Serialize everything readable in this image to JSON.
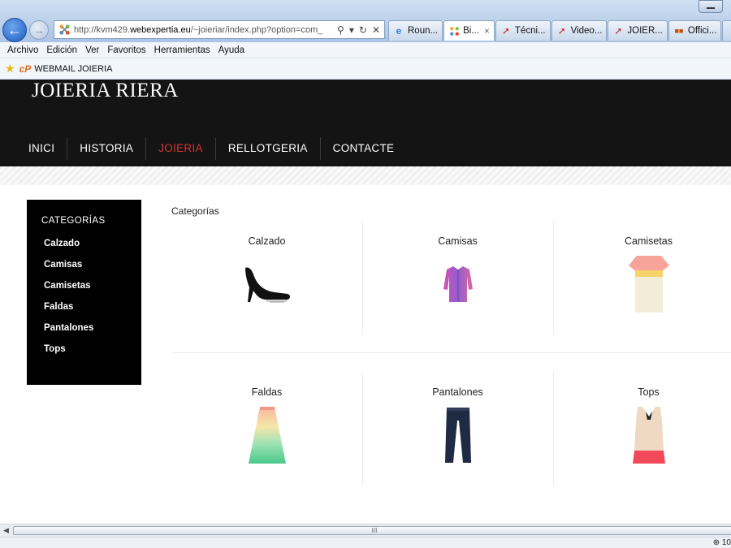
{
  "browser": {
    "url_prefix": "http://kvm429.",
    "url_domain": "webexpertia.eu",
    "url_rest": "/~joieriar/index.php?option=com_",
    "tabs": [
      {
        "label": "Roun...",
        "active": false
      },
      {
        "label": "Bi...",
        "active": true
      },
      {
        "label": "Técni...",
        "active": false
      },
      {
        "label": "Video...",
        "active": false
      },
      {
        "label": "JOIER...",
        "active": false
      },
      {
        "label": "Offici...",
        "active": false
      }
    ],
    "tab_close": "×",
    "menu": [
      "Archivo",
      "Edición",
      "Ver",
      "Favoritos",
      "Herramientas",
      "Ayuda"
    ],
    "favorite_link": "WEBMAIL JOIERIA",
    "favorite_cp": "cP",
    "scroll_grip": "III",
    "zoom": "10"
  },
  "site": {
    "title": "JOIERIA RIERA",
    "nav": [
      {
        "label": "INICI",
        "active": false
      },
      {
        "label": "HISTORIA",
        "active": false
      },
      {
        "label": "JOIERIA",
        "active": true
      },
      {
        "label": "RELLOTGERIA",
        "active": false
      },
      {
        "label": "CONTACTE",
        "active": false
      }
    ],
    "accent_color": "#d6332f"
  },
  "sidebar": {
    "title": "CATEGORÍAS",
    "items": [
      "Calzado",
      "Camisas",
      "Camisetas",
      "Faldas",
      "Pantalones",
      "Tops"
    ]
  },
  "content": {
    "heading": "Categorías",
    "categories": [
      {
        "label": "Calzado",
        "icon": "high-heel-shoe-icon"
      },
      {
        "label": "Camisas",
        "icon": "shirt-icon"
      },
      {
        "label": "Camisetas",
        "icon": "tshirt-icon"
      },
      {
        "label": "Faldas",
        "icon": "skirt-icon"
      },
      {
        "label": "Pantalones",
        "icon": "jeans-icon"
      },
      {
        "label": "Tops",
        "icon": "top-icon"
      }
    ]
  }
}
